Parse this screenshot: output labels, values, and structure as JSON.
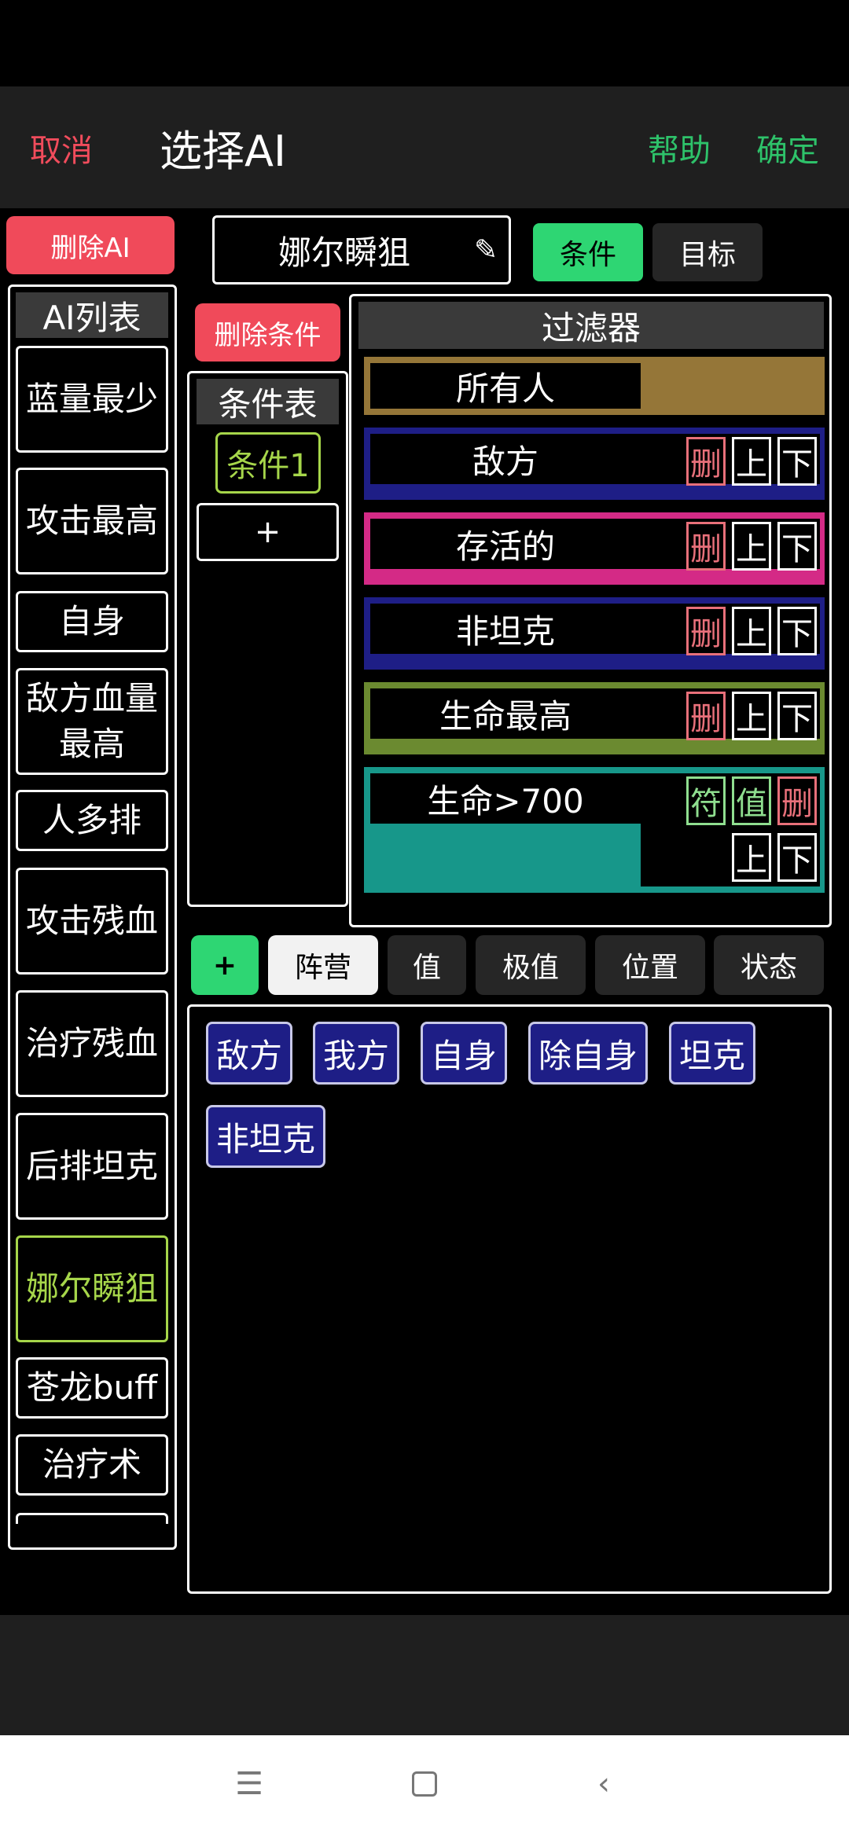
{
  "header": {
    "cancel": "取消",
    "title": "选择AI",
    "help": "帮助",
    "confirm": "确定"
  },
  "left": {
    "delete_ai": "删除AI",
    "list_title": "AI列表",
    "items": [
      "蓝量最少",
      "攻击最高",
      "自身",
      "敌方血量最高",
      "人多排",
      "攻击残血",
      "治疗残血",
      "后排坦克",
      "娜尔瞬狙",
      "苍龙buff",
      "治疗术"
    ]
  },
  "ai_name": "娜尔瞬狙",
  "mode_tabs": {
    "condition": "条件",
    "target": "目标"
  },
  "condition": {
    "delete": "删除条件",
    "table_title": "条件表",
    "item1": "条件1",
    "add": "+"
  },
  "filter": {
    "title": "过滤器",
    "rows": [
      "所有人",
      "敌方",
      "存活的",
      "非坦克",
      "生命最高",
      "生命>700"
    ],
    "del": "删",
    "up": "上",
    "down": "下",
    "sym": "符",
    "val": "值"
  },
  "bottom_tabs": {
    "add": "+",
    "camp": "阵营",
    "value": "值",
    "extreme": "极值",
    "position": "位置",
    "state": "状态"
  },
  "chips": [
    "敌方",
    "我方",
    "自身",
    "除自身",
    "坦克",
    "非坦克"
  ],
  "colors": {
    "accent_green": "#2ed673",
    "danger": "#f04a5a",
    "selected": "#a6d64a"
  }
}
